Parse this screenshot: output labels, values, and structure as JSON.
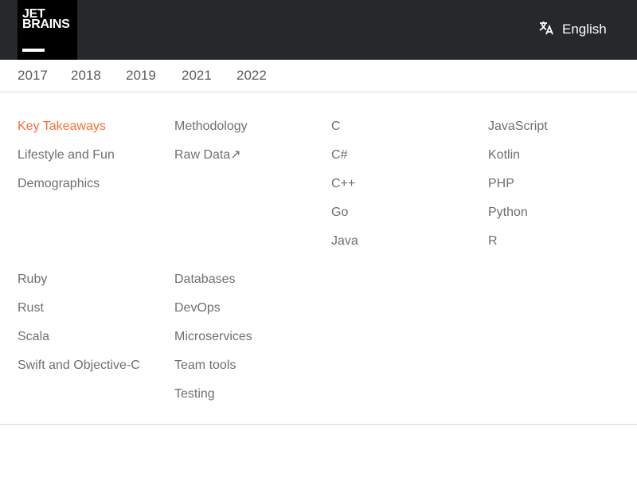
{
  "header": {
    "logo_line1": "JET",
    "logo_line2": "BRAINS",
    "language_label": "English",
    "language_icon": "translate-icon"
  },
  "years": [
    "2017",
    "2018",
    "2019",
    "2021",
    "2022"
  ],
  "menu": {
    "col1": [
      "Key Takeaways",
      "Lifestyle and Fun",
      "Demographics"
    ],
    "col2": [
      "Methodology",
      "Raw Data↗"
    ],
    "col3": [
      "C",
      "C#",
      "C++",
      "Go",
      "Java"
    ],
    "col4": [
      "JavaScript",
      "Kotlin",
      "PHP",
      "Python",
      "R"
    ],
    "col5": [
      "Ruby",
      "Rust",
      "Scala",
      "Swift and Objective-C"
    ],
    "col6": [
      "Databases",
      "DevOps",
      "Microservices",
      "Team tools",
      "Testing"
    ]
  },
  "colors": {
    "header_bg": "#27282c",
    "active": "#ff6d3a",
    "text": "#6f6f6f"
  }
}
